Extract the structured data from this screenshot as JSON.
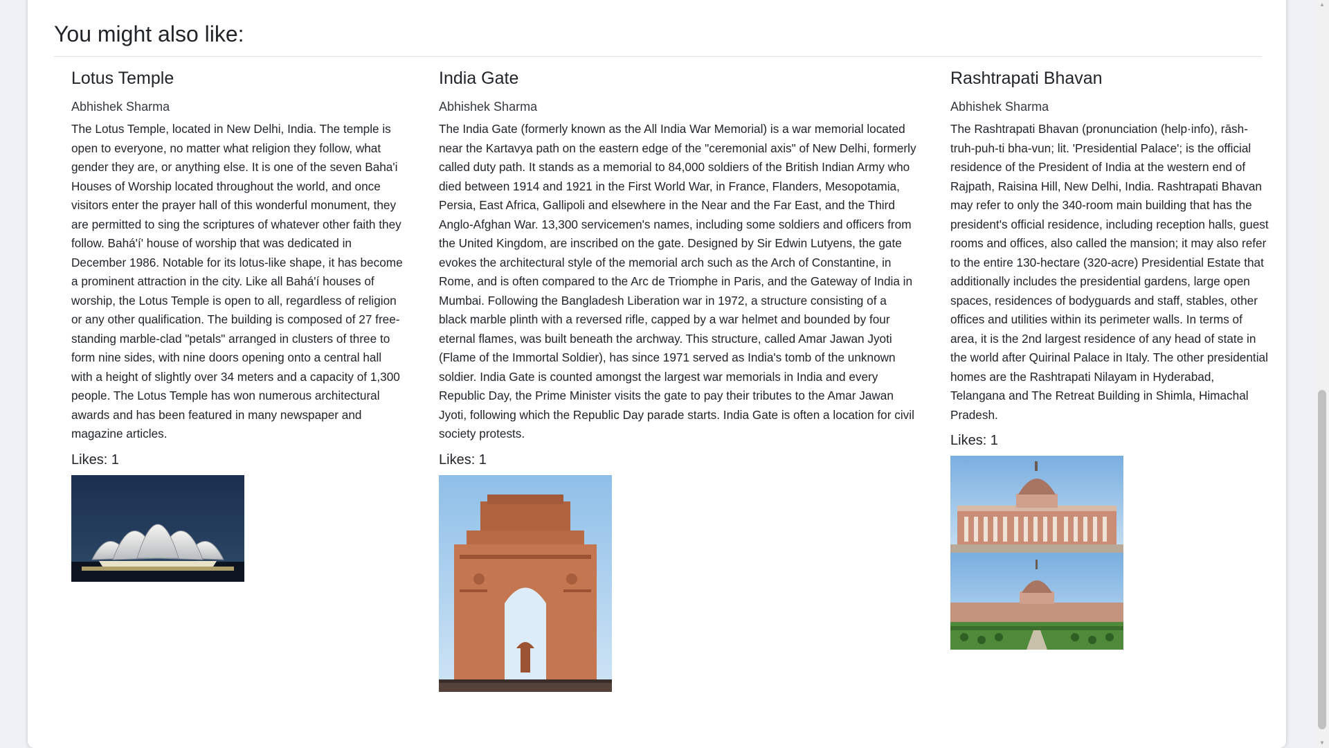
{
  "section": {
    "title": "You might also like:"
  },
  "cards": [
    {
      "title": "Lotus Temple",
      "author": "Abhishek Sharma",
      "description": "The Lotus Temple, located in New Delhi, India. The temple is open to everyone, no matter what religion they follow, what gender they are, or anything else. It is one of the seven Baha'i Houses of Worship located throughout the world, and once visitors enter the prayer hall of this wonderful monument, they are permitted to sing the scriptures of whatever other faith they follow. Bahá'í' house of worship that was dedicated in December 1986. Notable for its lotus-like shape, it has become a prominent attraction in the city. Like all Bahá'í houses of worship, the Lotus Temple is open to all, regardless of religion or any other qualification. The building is composed of 27 free-standing marble-clad \"petals\" arranged in clusters of three to form nine sides, with nine doors opening onto a central hall with a height of slightly over 34 meters and a capacity of 1,300 people. The Lotus Temple has won numerous architectural awards and has been featured in many newspaper and magazine articles.",
      "likes": "Likes: 1",
      "image_icon": "lotus-temple-photo"
    },
    {
      "title": "India Gate",
      "author": "Abhishek Sharma",
      "description": "The India Gate (formerly known as the All India War Memorial) is a war memorial located near the Kartavya path on the eastern edge of the \"ceremonial axis\" of New Delhi, formerly called duty path. It stands as a memorial to 84,000 soldiers of the British Indian Army who died between 1914 and 1921 in the First World War, in France, Flanders, Mesopotamia, Persia, East Africa, Gallipoli and elsewhere in the Near and the Far East, and the Third Anglo-Afghan War. 13,300 servicemen's names, including some soldiers and officers from the United Kingdom, are inscribed on the gate. Designed by Sir Edwin Lutyens, the gate evokes the architectural style of the memorial arch such as the Arch of Constantine, in Rome, and is often compared to the Arc de Triomphe in Paris, and the Gateway of India in Mumbai. Following the Bangladesh Liberation war in 1972, a structure consisting of a black marble plinth with a reversed rifle, capped by a war helmet and bounded by four eternal flames, was built beneath the archway. This structure, called Amar Jawan Jyoti (Flame of the Immortal Soldier), has since 1971 served as India's tomb of the unknown soldier. India Gate is counted amongst the largest war memorials in India and every Republic Day, the Prime Minister visits the gate to pay their tributes to the Amar Jawan Jyoti, following which the Republic Day parade starts. India Gate is often a location for civil society protests.",
      "likes": "Likes: 1",
      "image_icon": "india-gate-photo"
    },
    {
      "title": "Rashtrapati Bhavan",
      "author": "Abhishek Sharma",
      "description": "The Rashtrapati Bhavan (pronunciation (help·info), rāsh-truh-puh-ti bha-vun; lit. 'Presidential Palace'; is the official residence of the President of India at the western end of Rajpath, Raisina Hill, New Delhi, India. Rashtrapati Bhavan may refer to only the 340-room main building that has the president's official residence, including reception halls, guest rooms and offices, also called the mansion; it may also refer to the entire 130-hectare (320-acre) Presidential Estate that additionally includes the presidential gardens, large open spaces, residences of bodyguards and staff, stables, other offices and utilities within its perimeter walls. In terms of area, it is the 2nd largest residence of any head of state in the world after Quirinal Palace in Italy. The other presidential homes are the Rashtrapati Nilayam in Hyderabad, Telangana and The Retreat Building in Shimla, Himachal Pradesh.",
      "likes": "Likes: 1",
      "image_icon": "rashtrapati-bhavan-photo"
    }
  ],
  "colors": {
    "page_bg": "#eef0f6",
    "card_bg": "#ffffff",
    "text": "#212529",
    "divider": "#dee2e6"
  }
}
